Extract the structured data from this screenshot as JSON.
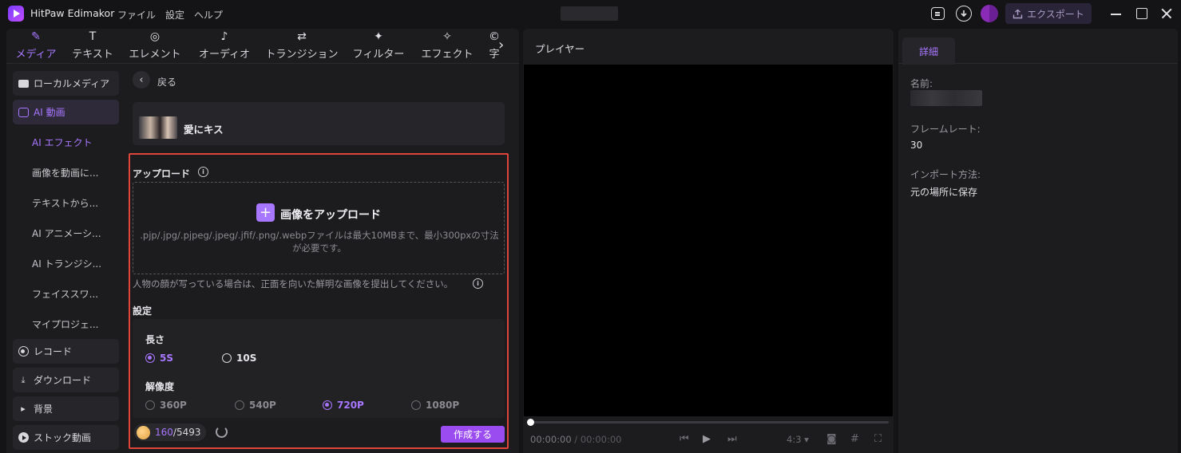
{
  "app": {
    "title": "HitPaw Edimakor",
    "menu": [
      "ファイル",
      "設定",
      "ヘルプ"
    ],
    "export_label": "エクスポート"
  },
  "colors": {
    "accent": "#a877ff",
    "highlight_frame": "#e0453c",
    "create_button": "#9a4cf0"
  },
  "tabs": [
    {
      "label": "メディア",
      "icon": "media-icon",
      "active": true
    },
    {
      "label": "テキスト",
      "icon": "text-icon"
    },
    {
      "label": "エレメント",
      "icon": "element-icon"
    },
    {
      "label": "オーディオ",
      "icon": "audio-icon"
    },
    {
      "label": "トランジション",
      "icon": "transition-icon"
    },
    {
      "label": "フィルター",
      "icon": "filter-icon"
    },
    {
      "label": "エフェクト",
      "icon": "effect-icon"
    },
    {
      "label": "字",
      "icon": "subtitle-icon"
    }
  ],
  "sidebar": {
    "local_media": "ローカルメディア",
    "ai_video": "AI 動画",
    "sub_items": [
      "AI エフェクト",
      "画像を動画に...",
      "テキストから...",
      "AI アニメーシ...",
      "AI トランジシ...",
      "フェイススワ...",
      "マイプロジェ..."
    ],
    "record": "レコード",
    "download": "ダウンロード",
    "background": "背景",
    "stock_video": "ストック動画"
  },
  "content": {
    "back_label": "戻る",
    "effect_name": "愛にキス",
    "upload_heading": "アップロード",
    "upload_cta": "画像をアップロード",
    "upload_hint": ".pjp/.jpg/.pjpeg/.jpeg/.jfif/.png/.webpファイルは最大10MBまで、最小300pxの寸法が必要です。",
    "face_note": "人物の顔が写っている場合は、正面を向いた鮮明な画像を提出してください。",
    "settings_heading": "設定",
    "length_label": "長さ",
    "length_options": [
      {
        "label": "5S",
        "selected": true
      },
      {
        "label": "10S",
        "selected": false
      }
    ],
    "resolution_label": "解像度",
    "resolution_options": [
      {
        "label": "360P",
        "selected": false
      },
      {
        "label": "540P",
        "selected": false
      },
      {
        "label": "720P",
        "selected": true
      },
      {
        "label": "1080P",
        "selected": false
      }
    ],
    "credits_used": "160",
    "credits_total": "/5493",
    "create_label": "作成する"
  },
  "player": {
    "title": "プレイヤー",
    "time_current": "00:00:00",
    "time_separator": " / ",
    "time_total": "00:00:00",
    "aspect_ratio": "4:3",
    "progress": 0
  },
  "details": {
    "tab_label": "詳細",
    "name_label": "名前:",
    "framerate_label": "フレームレート:",
    "framerate_value": "30",
    "import_label": "インポート方法:",
    "import_value": "元の場所に保存"
  }
}
